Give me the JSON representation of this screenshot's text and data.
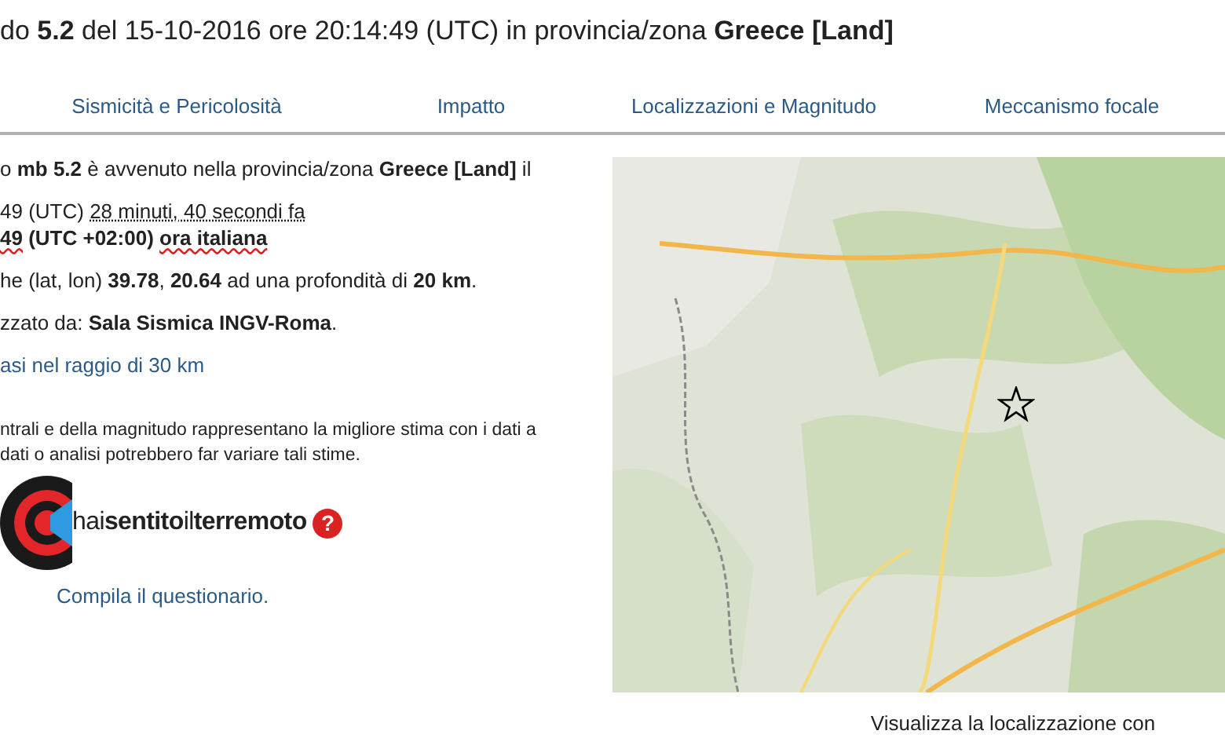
{
  "title": "do **5.2** del 15-10-2016 ore 20:14:49 (UTC) in provincia/zona **Greece [Land]**",
  "tabs": [
    {
      "label": "Sismicità e Pericolosità",
      "selected": false
    },
    {
      "label": "Impatto",
      "selected": false
    },
    {
      "label": "Localizzazioni e Magnitudo",
      "selected": false
    },
    {
      "label": "Meccanismo focale",
      "selected": false
    }
  ],
  "summary": "o **mb 5.2** è avvenuto nella provincia/zona **Greece [Land]** il",
  "utc_time": {
    "text": "49 (UTC) ",
    "ago": "28 minuti, 40 secondi fa"
  },
  "local_time": [
    {
      "text": "49",
      "spell_flag": true
    },
    {
      "text": " (UTC +02:00) ",
      "spell_flag": false
    },
    {
      "text": "ora italiana",
      "spell_flag": true
    }
  ],
  "location": "he (lat, lon) **39.78**, **20.64** ad una profondità di **20 km**.",
  "located_by": "zzato da: **Sala Sismica INGV-Roma**.",
  "nearby_link": "asi nel raggio di 30 km",
  "disclaimer": [
    "ntrali e della magnitudo rappresentano la migliore stima con i dati a",
    " dati o analisi potrebbero far variare tali stime."
  ],
  "survey": {
    "logo_text": "hai**sentito**il**terremoto**",
    "help": "?",
    "link": "Compila il questionario."
  },
  "map": {
    "kind": "picture"
  },
  "map_caption": "Visualizza la localizzazione con"
}
